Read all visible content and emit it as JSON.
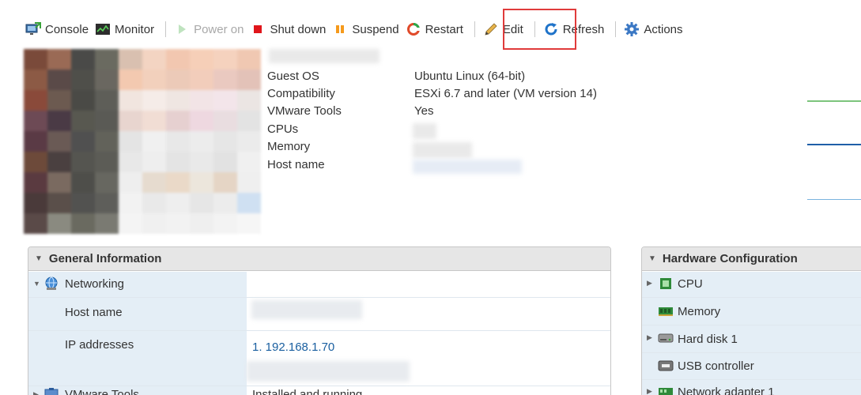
{
  "toolbar": {
    "console": "Console",
    "monitor": "Monitor",
    "power_on": "Power on",
    "shut_down": "Shut down",
    "suspend": "Suspend",
    "restart": "Restart",
    "edit": "Edit",
    "refresh": "Refresh",
    "actions": "Actions"
  },
  "summary": {
    "rows": [
      {
        "label": "Guest OS",
        "value": "Ubuntu Linux (64-bit)"
      },
      {
        "label": "Compatibility",
        "value": "ESXi 6.7 and later (VM version 14)"
      },
      {
        "label": "VMware Tools",
        "value": "Yes"
      },
      {
        "label": "CPUs",
        "value": ""
      },
      {
        "label": "Memory",
        "value": ""
      },
      {
        "label": "Host name",
        "value": ""
      }
    ]
  },
  "general_info": {
    "title": "General Information",
    "networking": "Networking",
    "host_name_label": "Host name",
    "ip_addresses_label": "IP addresses",
    "ip_value": "1. 192.168.1.70",
    "vmware_tools_label": "VMware Tools",
    "vmware_tools_value": "Installed and running"
  },
  "hardware": {
    "title": "Hardware Configuration",
    "items": [
      "CPU",
      "Memory",
      "Hard disk 1",
      "USB controller",
      "Network adapter 1"
    ]
  },
  "colors": {
    "accent": "#1a5fa0",
    "highlight_border": "#e03b3b",
    "panel_header": "#e6e6e6",
    "label_cell": "#e4eef6"
  }
}
